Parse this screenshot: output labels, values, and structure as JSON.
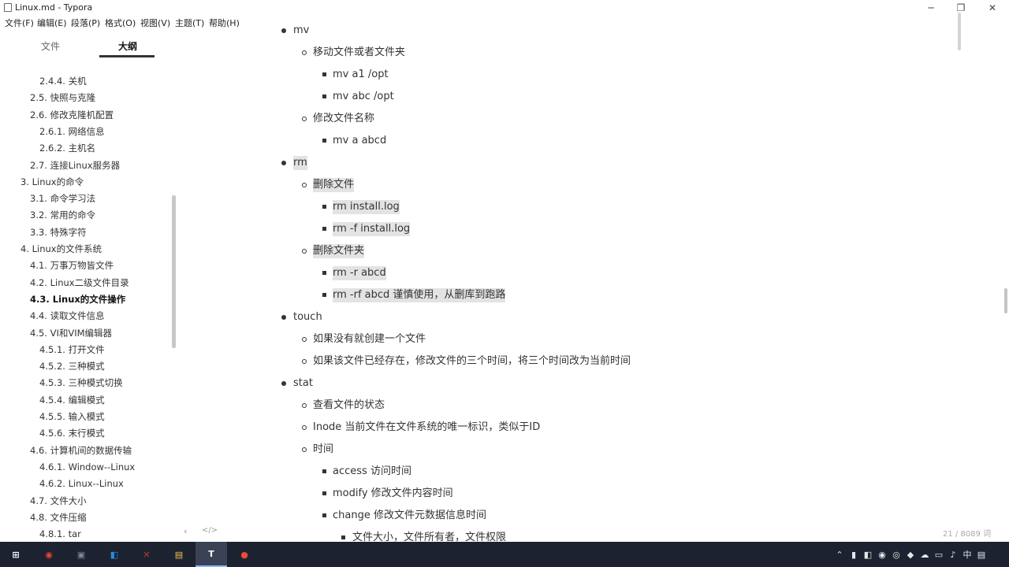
{
  "window": {
    "title": "Linux.md - Typora"
  },
  "menu": [
    {
      "label": "文件(F)"
    },
    {
      "label": "编辑(E)"
    },
    {
      "label": "段落(P)"
    },
    {
      "label": "格式(O)"
    },
    {
      "label": "视图(V)"
    },
    {
      "label": "主题(T)"
    },
    {
      "label": "帮助(H)"
    }
  ],
  "sidebar": {
    "tabs": [
      {
        "label": "文件"
      },
      {
        "label": "大纲"
      }
    ],
    "active_tab": "大纲",
    "outline": [
      {
        "label": "2.4.4. 关机"
      },
      {
        "label": "2.5. 快照与克隆"
      },
      {
        "label": "2.6. 修改克隆机配置"
      },
      {
        "label": "2.6.1. 网络信息"
      },
      {
        "label": "2.6.2. 主机名"
      },
      {
        "label": "2.7. 连接Linux服务器"
      },
      {
        "label": "3. Linux的命令"
      },
      {
        "label": "3.1. 命令学习法"
      },
      {
        "label": "3.2. 常用的命令"
      },
      {
        "label": "3.3. 特殊字符"
      },
      {
        "label": "4. Linux的文件系统"
      },
      {
        "label": "4.1. 万事万物皆文件"
      },
      {
        "label": "4.2. Linux二级文件目录"
      },
      {
        "label": "4.3. Linux的文件操作",
        "active": true
      },
      {
        "label": "4.4. 读取文件信息"
      },
      {
        "label": "4.5. VI和VIM编辑器"
      },
      {
        "label": "4.5.1. 打开文件"
      },
      {
        "label": "4.5.2. 三种模式"
      },
      {
        "label": "4.5.3. 三种模式切换"
      },
      {
        "label": "4.5.4. 编辑模式"
      },
      {
        "label": "4.5.5. 输入模式"
      },
      {
        "label": "4.5.6. 末行模式"
      },
      {
        "label": "4.6. 计算机间的数据传输"
      },
      {
        "label": "4.6.1. Window--Linux"
      },
      {
        "label": "4.6.2. Linux--Linux"
      },
      {
        "label": "4.7. 文件大小"
      },
      {
        "label": "4.8. 文件压缩"
      },
      {
        "label": "4.8.1. tar"
      }
    ],
    "footer": {
      "back": "‹",
      "source_toggle": "</>"
    }
  },
  "document": [
    {
      "text": "mv"
    },
    {
      "text": "移动文件或者文件夹"
    },
    {
      "text": "mv a1 /opt"
    },
    {
      "text": "mv abc /opt"
    },
    {
      "text": "修改文件名称"
    },
    {
      "text": "mv a abcd"
    },
    {
      "text": "rm",
      "selected": true
    },
    {
      "text": "删除文件",
      "selected": true
    },
    {
      "text": "rm install.log",
      "selected": true
    },
    {
      "text": "rm -f install.log",
      "selected": true
    },
    {
      "text": "删除文件夹",
      "selected": true
    },
    {
      "text": "rm -r abcd",
      "selected": true
    },
    {
      "text": "rm -rf abcd  谨慎使用，从删库到跑路",
      "selected": true
    },
    {
      "text": "touch"
    },
    {
      "text": "如果没有就创建一个文件"
    },
    {
      "text": "如果该文件已经存在，修改文件的三个时间，将三个时间改为当前时间"
    },
    {
      "text": "stat"
    },
    {
      "text": "查看文件的状态"
    },
    {
      "text": "Inode 当前文件在文件系统的唯一标识，类似于ID"
    },
    {
      "text": "时间"
    },
    {
      "text": "access 访问时间"
    },
    {
      "text": "modify 修改文件内容时间"
    },
    {
      "text": "change 修改文件元数据信息时间"
    },
    {
      "text": "文件大小，文件所有者，文件权限"
    }
  ],
  "status": {
    "word_count": "21 / 8089 词"
  },
  "taskbar": {
    "apps": [
      {
        "name": "windows-start",
        "color": "#ffffff"
      },
      {
        "name": "chrome",
        "color": "#e8453c"
      },
      {
        "name": "vmware",
        "color": "#7a8598"
      },
      {
        "name": "app-blue",
        "color": "#2a8bd8"
      },
      {
        "name": "xshell",
        "color": "#c0392b"
      },
      {
        "name": "file-explorer",
        "color": "#f2c14e"
      },
      {
        "name": "typora",
        "color": "#ffffff"
      },
      {
        "name": "recorder",
        "color": "#e74c3c"
      }
    ],
    "ime": "中"
  },
  "colors": {
    "selection": "#e3e3e3",
    "taskbar": "#1c2230"
  }
}
